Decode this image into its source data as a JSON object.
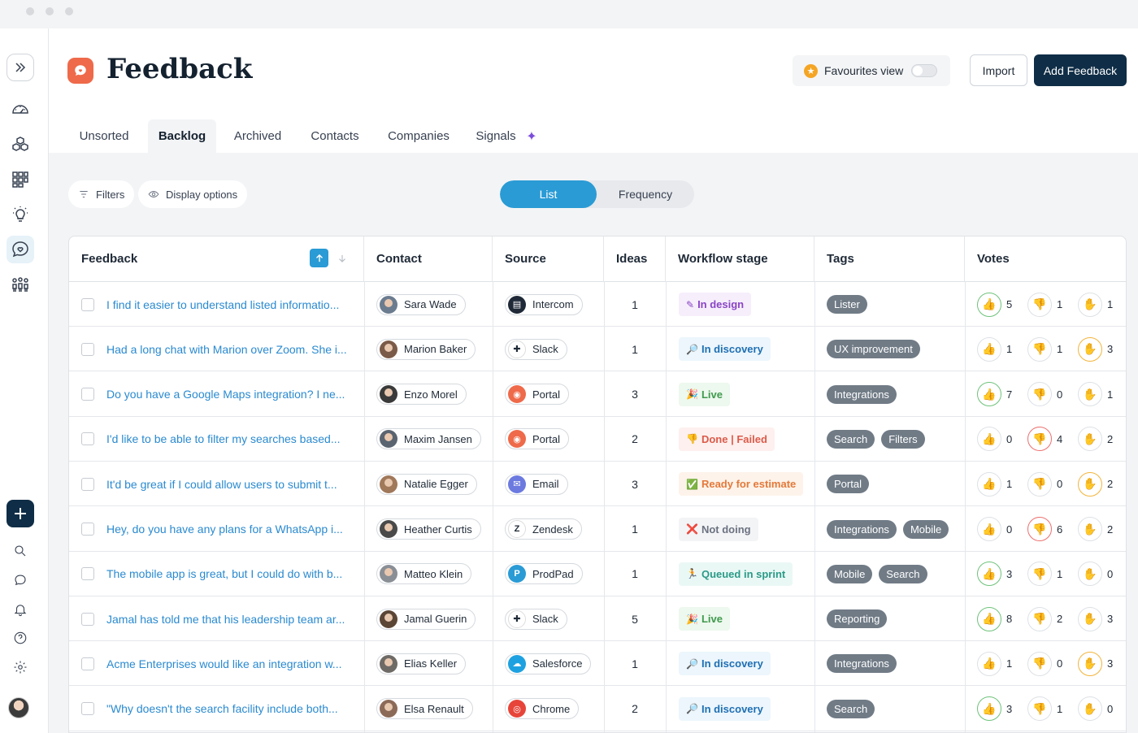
{
  "header": {
    "title": "Feedback",
    "favourites_label": "Favourites view",
    "import_label": "Import",
    "add_label": "Add Feedback"
  },
  "tabs": [
    {
      "label": "Unsorted"
    },
    {
      "label": "Backlog"
    },
    {
      "label": "Archived"
    },
    {
      "label": "Contacts"
    },
    {
      "label": "Companies"
    },
    {
      "label": "Signals"
    }
  ],
  "toolbar": {
    "filters_label": "Filters",
    "display_label": "Display options",
    "view_list": "List",
    "view_frequency": "Frequency"
  },
  "columns": {
    "feedback": "Feedback",
    "contact": "Contact",
    "source": "Source",
    "ideas": "Ideas",
    "workflow": "Workflow stage",
    "tags": "Tags",
    "votes": "Votes"
  },
  "rows": [
    {
      "text": "I find it easier to understand listed informatio...",
      "contact": "Sara Wade",
      "source": "Intercom",
      "ideas": "1",
      "stage": "In design",
      "tags": [
        "Lister"
      ],
      "votes": [
        "5",
        "1",
        "1"
      ],
      "hl": [
        "g",
        "",
        ""
      ]
    },
    {
      "text": "Had a long chat with Marion over Zoom. She i...",
      "contact": "Marion Baker",
      "source": "Slack",
      "ideas": "1",
      "stage": "In discovery",
      "tags": [
        "UX improvement"
      ],
      "votes": [
        "1",
        "1",
        "3"
      ],
      "hl": [
        "",
        "",
        "y"
      ]
    },
    {
      "text": "Do you have a Google Maps integration? I ne...",
      "contact": "Enzo Morel",
      "source": "Portal",
      "ideas": "3",
      "stage": "Live",
      "tags": [
        "Integrations"
      ],
      "votes": [
        "7",
        "0",
        "1"
      ],
      "hl": [
        "g",
        "",
        ""
      ]
    },
    {
      "text": "I'd like to be able to filter my searches based...",
      "contact": "Maxim Jansen",
      "source": "Portal",
      "ideas": "2",
      "stage": "Done | Failed",
      "tags": [
        "Search",
        "Filters"
      ],
      "votes": [
        "0",
        "4",
        "2"
      ],
      "hl": [
        "",
        "r",
        ""
      ]
    },
    {
      "text": "It'd be great if I could allow users to submit t...",
      "contact": "Natalie Egger",
      "source": "Email",
      "ideas": "3",
      "stage": "Ready for estimate",
      "tags": [
        "Portal"
      ],
      "votes": [
        "1",
        "0",
        "2"
      ],
      "hl": [
        "",
        "",
        "y"
      ]
    },
    {
      "text": "Hey, do you have any plans for a WhatsApp i...",
      "contact": "Heather Curtis",
      "source": "Zendesk",
      "ideas": "1",
      "stage": "Not doing",
      "tags": [
        "Integrations",
        "Mobile"
      ],
      "votes": [
        "0",
        "6",
        "2"
      ],
      "hl": [
        "",
        "r",
        ""
      ]
    },
    {
      "text": "The mobile app is great, but I could do with b...",
      "contact": "Matteo Klein",
      "source": "ProdPad",
      "ideas": "1",
      "stage": "Queued in sprint",
      "tags": [
        "Mobile",
        "Search"
      ],
      "votes": [
        "3",
        "1",
        "0"
      ],
      "hl": [
        "g",
        "",
        ""
      ]
    },
    {
      "text": "Jamal has told me that his leadership team ar...",
      "contact": "Jamal Guerin",
      "source": "Slack",
      "ideas": "5",
      "stage": "Live",
      "tags": [
        "Reporting"
      ],
      "votes": [
        "8",
        "2",
        "3"
      ],
      "hl": [
        "g",
        "",
        ""
      ]
    },
    {
      "text": "Acme Enterprises would like an integration w...",
      "contact": "Elias Keller",
      "source": "Salesforce",
      "ideas": "1",
      "stage": "In discovery",
      "tags": [
        "Integrations"
      ],
      "votes": [
        "1",
        "0",
        "3"
      ],
      "hl": [
        "",
        "",
        "y"
      ]
    },
    {
      "text": "\"Why doesn't the search facility include both...",
      "contact": "Elsa Renault",
      "source": "Chrome",
      "ideas": "2",
      "stage": "In discovery",
      "tags": [
        "Search"
      ],
      "votes": [
        "3",
        "1",
        "0"
      ],
      "hl": [
        "g",
        "",
        ""
      ]
    }
  ],
  "stage_styles": {
    "In design": {
      "bg": "#f6eefb",
      "fg": "#8a44c6",
      "emoji": "✎"
    },
    "In discovery": {
      "bg": "#ecf6fc",
      "fg": "#1f6fb3",
      "emoji": "🔎"
    },
    "Live": {
      "bg": "#edf8ee",
      "fg": "#3f9a4d",
      "emoji": "🎉"
    },
    "Done | Failed": {
      "bg": "#fdf0ee",
      "fg": "#dc5a4a",
      "emoji": "👎"
    },
    "Ready for estimate": {
      "bg": "#fdf3ea",
      "fg": "#e4793a",
      "emoji": "✅"
    },
    "Not doing": {
      "bg": "#f3f4f6",
      "fg": "#6b7280",
      "emoji": "❌"
    },
    "Queued in sprint": {
      "bg": "#eaf8f5",
      "fg": "#2a9a87",
      "emoji": "🏃"
    }
  },
  "source_styles": {
    "Intercom": {
      "bg": "#1f2937",
      "glyph": "▤"
    },
    "Slack": {
      "bg": "#ffffff",
      "glyph": "✚"
    },
    "Portal": {
      "bg": "#ee6a4a",
      "glyph": "◉"
    },
    "Email": {
      "bg": "#6c7ae0",
      "glyph": "✉"
    },
    "Zendesk": {
      "bg": "#ffffff",
      "glyph": "Z"
    },
    "ProdPad": {
      "bg": "#2a9bd5",
      "glyph": "P"
    },
    "Salesforce": {
      "bg": "#1ea1e0",
      "glyph": "☁"
    },
    "Chrome": {
      "bg": "#e7453a",
      "glyph": "◎"
    }
  },
  "vote_icons": [
    "👍",
    "👎",
    "✋"
  ]
}
